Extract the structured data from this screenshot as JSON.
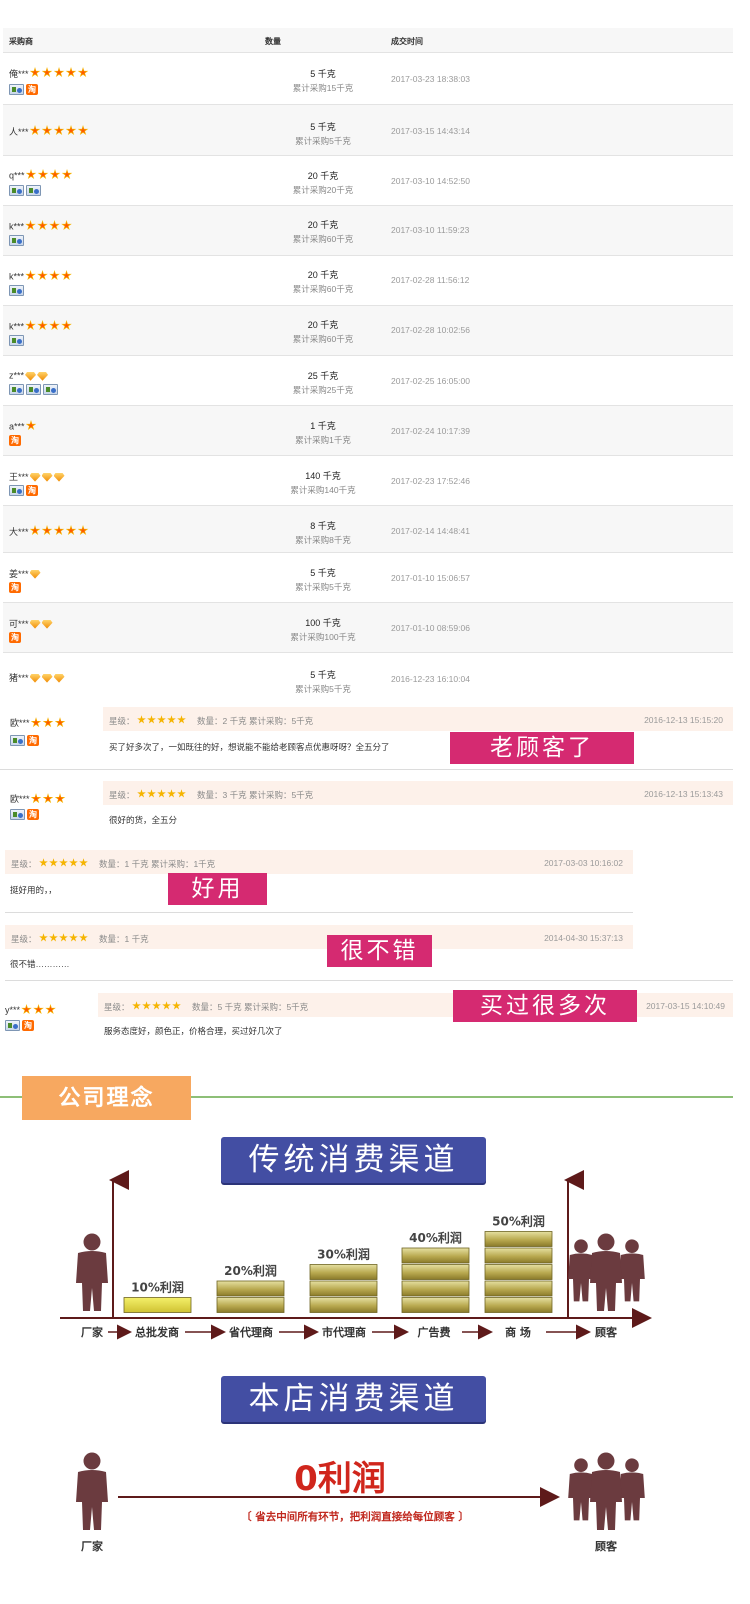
{
  "table": {
    "headers": {
      "buyer": "采购商",
      "qty": "数量",
      "time": "成交时间"
    },
    "rows": [
      {
        "buyer": "俺***",
        "icons": "star",
        "level": 5,
        "badges": [
          "shop-badge",
          "tao-badge"
        ],
        "qty": "5 千克",
        "total": "累计采购15千克",
        "time": "2017-03-23 18:38:03"
      },
      {
        "buyer": "人***",
        "icons": "star",
        "level": 5,
        "badges": [],
        "qty": "5 千克",
        "total": "累计采购5千克",
        "time": "2017-03-15 14:43:14"
      },
      {
        "buyer": "q***",
        "icons": "star",
        "level": 4,
        "badges": [
          "shop-badge",
          "shop-badge"
        ],
        "qty": "20 千克",
        "total": "累计采购20千克",
        "time": "2017-03-10 14:52:50"
      },
      {
        "buyer": "k***",
        "icons": "star",
        "level": 4,
        "badges": [
          "shop-badge"
        ],
        "qty": "20 千克",
        "total": "累计采购60千克",
        "time": "2017-03-10 11:59:23"
      },
      {
        "buyer": "k***",
        "icons": "star",
        "level": 4,
        "badges": [
          "shop-badge"
        ],
        "qty": "20 千克",
        "total": "累计采购60千克",
        "time": "2017-02-28 11:56:12"
      },
      {
        "buyer": "k***",
        "icons": "star",
        "level": 4,
        "badges": [
          "shop-badge"
        ],
        "qty": "20 千克",
        "total": "累计采购60千克",
        "time": "2017-02-28 10:02:56"
      },
      {
        "buyer": "z***",
        "icons": "diamond",
        "level": 2,
        "badges": [
          "shop-badge",
          "shop-badge",
          "shop-badge"
        ],
        "qty": "25 千克",
        "total": "累计采购25千克",
        "time": "2017-02-25 16:05:00"
      },
      {
        "buyer": "a***",
        "icons": "star",
        "level": 1,
        "badges": [
          "tao-badge"
        ],
        "qty": "1 千克",
        "total": "累计采购1千克",
        "time": "2017-02-24 10:17:39"
      },
      {
        "buyer": "王***",
        "icons": "diamond",
        "level": 3,
        "badges": [
          "shop-badge",
          "tao-badge"
        ],
        "qty": "140 千克",
        "total": "累计采购140千克",
        "time": "2017-02-23 17:52:46"
      },
      {
        "buyer": "大***",
        "icons": "star",
        "level": 5,
        "badges": [],
        "qty": "8 千克",
        "total": "累计采购8千克",
        "time": "2017-02-14 14:48:41"
      },
      {
        "buyer": "姜***",
        "icons": "diamond",
        "level": 1,
        "badges": [
          "tao-badge"
        ],
        "qty": "5 千克",
        "total": "累计采购5千克",
        "time": "2017-01-10 15:06:57"
      },
      {
        "buyer": "可***",
        "icons": "diamond",
        "level": 2,
        "badges": [
          "tao-badge"
        ],
        "qty": "100 千克",
        "total": "累计采购100千克",
        "time": "2017-01-10 08:59:06"
      },
      {
        "buyer": "猪***",
        "icons": "diamond",
        "level": 3,
        "badges": [],
        "qty": "5 千克",
        "total": "累计采购5千克",
        "time": "2016-12-23 16:10:04"
      }
    ]
  },
  "reviews": {
    "r1": {
      "buyer": "欧***",
      "level": 3,
      "rating_label": "星级：",
      "meta": "数量：2 千克   累计采购：5千克",
      "date": "2016-12-13 15:15:20",
      "text": "买了好多次了，一如既往的好，想说能不能给老顾客点优惠呀呀？全五分了",
      "tag": "老顾客了"
    },
    "r2": {
      "buyer": "欧***",
      "level": 3,
      "rating_label": "星级：",
      "meta": "数量：3 千克   累计采购：5千克",
      "date": "2016-12-13 15:13:43",
      "text": "很好的货，全五分"
    },
    "r3": {
      "rating_label": "星级：",
      "meta": "数量：1 千克   累计采购：1千克",
      "date": "2017-03-03 10:16:02",
      "text": "挺好用的，，",
      "tag": "好用"
    },
    "r4": {
      "rating_label": "星级：",
      "meta": "数量：1 千克",
      "date": "2014-04-30 15:37:13",
      "text": "很不错…………",
      "tag": "很不错"
    },
    "r5": {
      "buyer": "y***",
      "level": 3,
      "rating_label": "星级：",
      "meta": "数量：5 千克   累计采购：5千克",
      "date": "2017-03-15 14:10:49",
      "text": "服务态度好，颜色正，价格合理，买过好几次了",
      "tag": "买过很多次"
    }
  },
  "section": {
    "title": "公司理念"
  },
  "traditional": {
    "banner": "传统消费渠道",
    "stages": [
      "厂家",
      "总批发商",
      "省代理商",
      "市代理商",
      "广告费",
      "商 场",
      "顾客"
    ],
    "chart_data": {
      "type": "bar",
      "categories": [
        "总批发商",
        "省代理商",
        "市代理商",
        "广告费",
        "商 场"
      ],
      "values": [
        10,
        20,
        30,
        40,
        50
      ],
      "labels": [
        "10%利润",
        "20%利润",
        "30%利润",
        "40%利润",
        "50%利润"
      ]
    }
  },
  "ours": {
    "banner": "本店消费渠道",
    "profit": "0利润",
    "note": "〔 省去中间所有环节，把利润直接给每位顾客 〕",
    "left": "厂家",
    "right": "顾客"
  },
  "colors": {
    "accent_pink": "#d52a71",
    "banner_blue": "#434ea3",
    "section_orange": "#f7a860",
    "arrow_dark_red": "#5e1a1a",
    "profit_red": "#d0261c"
  }
}
